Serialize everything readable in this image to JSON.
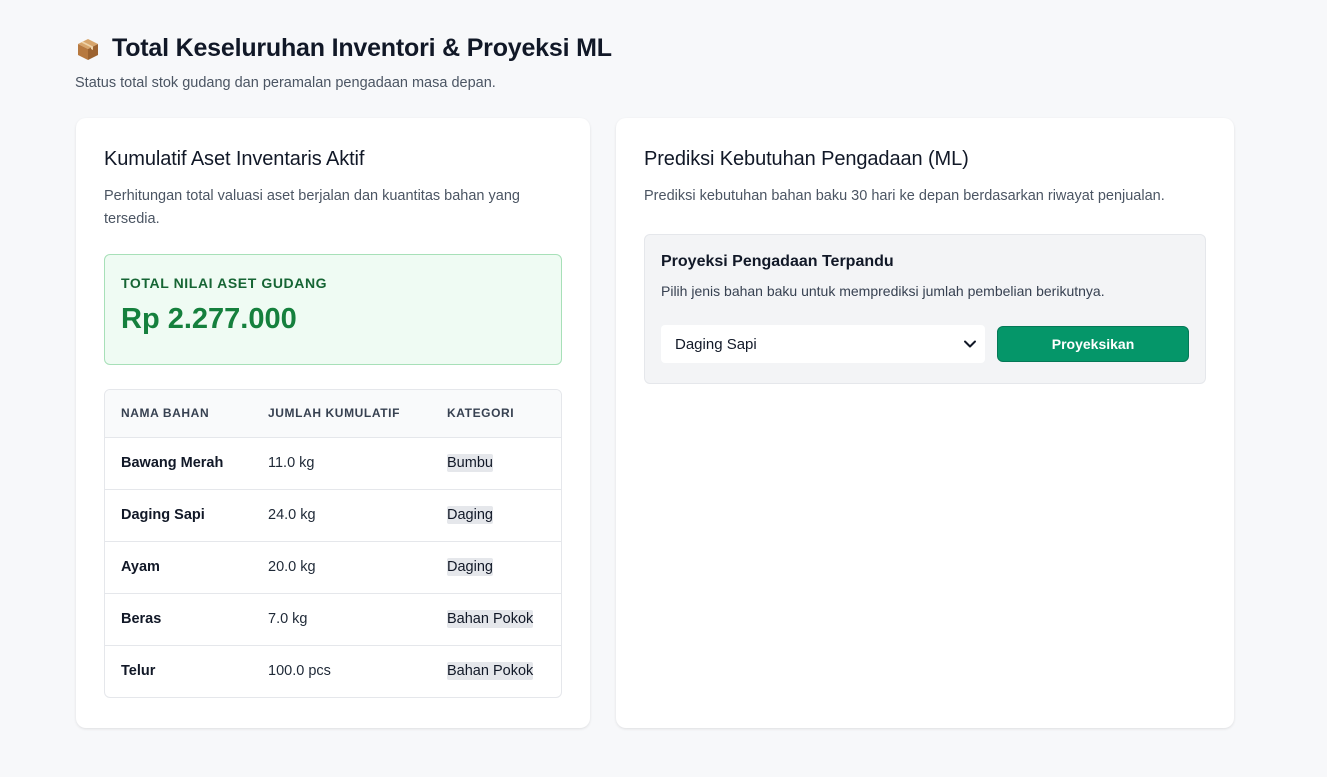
{
  "header": {
    "icon": "package-box-icon",
    "title": "Total Keseluruhan Inventori & Proyeksi ML",
    "subtitle": "Status total stok gudang dan peramalan pengadaan masa depan."
  },
  "inventory": {
    "title": "Kumulatif Aset Inventaris Aktif",
    "description": "Perhitungan total valuasi aset berjalan dan kuantitas bahan yang tersedia.",
    "asset_label": "TOTAL NILAI ASET GUDANG",
    "asset_value": "Rp 2.277.000",
    "table": {
      "headers": [
        "NAMA BAHAN",
        "JUMLAH KUMULATIF",
        "KATEGORI"
      ],
      "rows": [
        {
          "name": "Bawang Merah",
          "qty": "11.0 kg",
          "category": "Bumbu"
        },
        {
          "name": "Daging Sapi",
          "qty": "24.0 kg",
          "category": "Daging"
        },
        {
          "name": "Ayam",
          "qty": "20.0 kg",
          "category": "Daging"
        },
        {
          "name": "Beras",
          "qty": "7.0 kg",
          "category": "Bahan Pokok"
        },
        {
          "name": "Telur",
          "qty": "100.0 pcs",
          "category": "Bahan Pokok"
        }
      ]
    }
  },
  "prediction": {
    "title": "Prediksi Kebutuhan Pengadaan (ML)",
    "description": "Prediksi kebutuhan bahan baku 30 hari ke depan berdasarkan riwayat penjualan.",
    "panel_title": "Proyeksi Pengadaan Terpandu",
    "panel_desc": "Pilih jenis bahan baku untuk memprediksi jumlah pembelian berikutnya.",
    "selected_material": "Daging Sapi",
    "button_label": "Proyeksikan"
  },
  "colors": {
    "accent": "#059669",
    "asset_text": "#15803d",
    "asset_bg": "#effbf3"
  }
}
